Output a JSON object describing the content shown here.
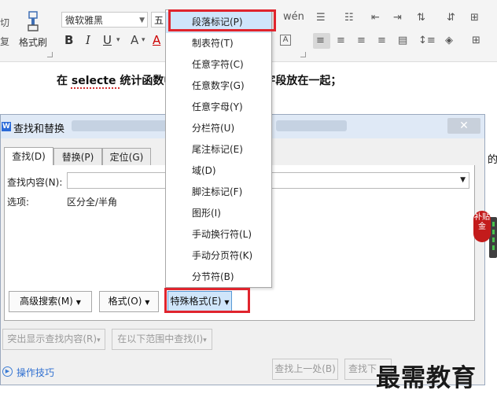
{
  "ribbon": {
    "cut_label": "切",
    "copy_label": "复",
    "format_brush_label": "格式刷",
    "font_name": "微软雅黑",
    "font_size": "五",
    "bold": "B",
    "italic": "I",
    "underline": "U",
    "font_color": "A"
  },
  "document": {
    "line_prefix": "在 ",
    "line_selecte": "selecte",
    "line_mid": " 统计函数中",
    "line_suffix": "需的字段放在一起；",
    "right_fragment": "的"
  },
  "dialog": {
    "title": "查找和替换",
    "tabs": [
      "查找(D)",
      "替换(P)",
      "定位(G)"
    ],
    "find_label": "查找内容(N):",
    "find_value": "",
    "options_label": "选项:",
    "options_value": "区分全/半角",
    "buttons": {
      "advanced": "高级搜索(M)",
      "format": "格式(O)",
      "special": "特殊格式(E)",
      "highlight": "突出显示查找内容(R)",
      "find_in": "在以下范围中查找(I)",
      "find_prev": "查找上一处(B)",
      "find_next": "查找下"
    },
    "help_link": "操作技巧"
  },
  "special_menu": {
    "items": [
      "段落标记(P)",
      "制表符(T)",
      "任意字符(C)",
      "任意数字(G)",
      "任意字母(Y)",
      "分栏符(U)",
      "尾注标记(E)",
      "域(D)",
      "脚注标记(F)",
      "图形(I)",
      "手动换行符(L)",
      "手动分页符(K)",
      "分节符(B)"
    ],
    "highlighted_index": 0
  },
  "side_badge": "补贴金",
  "watermark": "最需教育",
  "colors": {
    "highlight_box": "#e0242d",
    "menu_highlight": "#cfe5fb",
    "link": "#2f6fd0"
  }
}
